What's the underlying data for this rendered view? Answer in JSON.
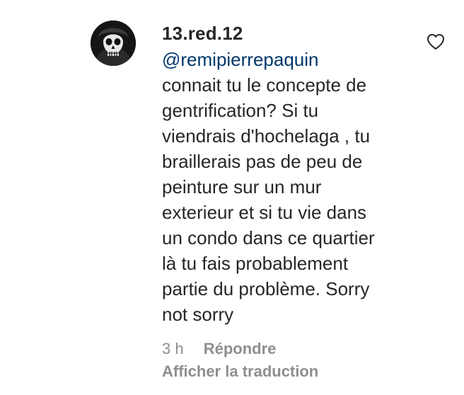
{
  "comment": {
    "username": "13.red.12",
    "mention": "@remipierrepaquin",
    "text": "connait tu le concepte de\ngentrification? Si tu\nviendrais d'hochelaga , tu\nbraillerais pas de peu de\npeinture sur un mur\nexterieur et si tu vie dans\nun condo dans ce quartier\nlà tu fais probablement\npartie du problème. Sorry\nnot sorry",
    "time": "3 h",
    "reply_label": "Répondre",
    "translate_label": "Afficher la traduction",
    "avatar_icon": "skull-avatar-icon",
    "like_icon": "heart-outline-icon"
  },
  "colors": {
    "text": "#262626",
    "mention": "#00376b",
    "secondary": "#8e8e8e"
  }
}
